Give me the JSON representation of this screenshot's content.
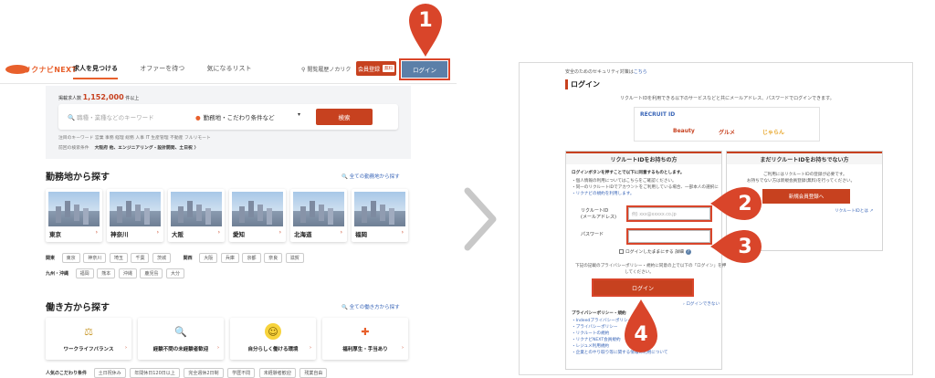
{
  "left": {
    "logo": "リクナビNEXT",
    "nav": [
      "求人を見つける",
      "オファーを待つ",
      "気になるリスト"
    ],
    "history": "閲覧履歴ノカリク",
    "register": {
      "label": "会員登録",
      "badge": "無料"
    },
    "login": "ログイン",
    "hero_count": {
      "prefix": "掲載求人数",
      "value": "1,152,000",
      "suffix": "件以上"
    },
    "search": {
      "keyword_placeholder": "職種・業種などのキーワード",
      "location": "勤務地・こだわり条件など",
      "button": "検索"
    },
    "keyword_row": "注目のキーワード  営業  事務  経理  総務  人事  IT  生産管理  不動産  フルリモート",
    "recent": {
      "label": "前回の検索条件",
      "value": "大阪府 他、エンジニアリング・設計開発、土日祝 〉"
    },
    "area_section": {
      "title": "勤務地から探す",
      "link": "全ての勤務地から探す"
    },
    "cities": [
      "東京",
      "神奈川",
      "大阪",
      "愛知",
      "北海道",
      "福岡"
    ],
    "pref_rows": [
      {
        "group1": "関東",
        "items1": [
          "東京",
          "神奈川",
          "埼玉",
          "千葉",
          "茨城"
        ],
        "group2": "関西",
        "items2": [
          "大阪",
          "兵庫",
          "京都",
          "奈良",
          "滋賀"
        ]
      },
      {
        "group1": "九州・沖縄",
        "items1": [
          "福岡",
          "熊本",
          "沖縄",
          "鹿児島",
          "大分"
        ],
        "group2": "",
        "items2": []
      }
    ],
    "style_section": {
      "title": "働き方から探す",
      "link": "全ての働き方から探す"
    },
    "styles": [
      {
        "label": "ワークライフバランス",
        "icon": "scale-icon"
      },
      {
        "label": "経験不問の未経験者歓迎",
        "icon": "magnifier-icon"
      },
      {
        "label": "自分らしく働ける環境",
        "icon": "smile-icon"
      },
      {
        "label": "福利厚生・手当あり",
        "icon": "benefit-icon"
      }
    ],
    "popular": {
      "label": "人気のこだわり条件",
      "items": [
        "土日祝休み",
        "年間休日120日以上",
        "完全週休2日制",
        "学歴不問",
        "未経験者歓迎",
        "残業自由"
      ]
    }
  },
  "right": {
    "security": "安全のためのセキュリティ対策は",
    "security_link": "こちら",
    "title": "ログイン",
    "desc": "リクルートIDを利用できる以下のサービスなどと共にメールアドレス、パスワードでログインできます。",
    "brands": [
      "RECRUIT ID",
      "Beauty",
      "グルメ",
      "じゃらん"
    ],
    "have_id": {
      "header": "リクルートIDをお持ちの方",
      "intro": "ログインボタンを押すことで以下に同意するものとします。",
      "notes": [
        "・個人情報の利用については",
        "こちら",
        "をご確認ください。",
        "・同一のリクルートIDでアカウントをご利用している場合、一部本人の選択に",
        "・リクナビの規約を利用します。"
      ],
      "id_label": [
        "リクルートID",
        "(メールアドレス)"
      ],
      "id_placeholder": "例) xxx@xxxxx.co.jp",
      "pw_label": "パスワード",
      "keep": "ログインしたままにする",
      "keep_detail": "詳細",
      "agree": [
        "下記の記載のプライバシーポリシー・規約に同意の上で以下の「ログイン」を押",
        "してください。"
      ],
      "login": "ログイン",
      "forgot": "ログインできない",
      "policy_head": "プライバシーポリシー・規約",
      "policy_items": [
        "・Indeedプライバシーポリシー",
        "・プライバシーポリシー",
        "・リクルートの規約",
        "・リクナビNEXT会員規約",
        "・レジュメ利用規約",
        "・企業とのやり取り等に関する情報の利用について"
      ]
    },
    "no_id": {
      "header": "まだリクルートIDをお持ちでない方",
      "line1": "ご利用にはリクルートIDの登録が必要です。",
      "line2": "お持ちでない方は新規会員登録(無料)を行ってください。",
      "button": "新規会員登録へ",
      "link": "リクルートIDとは"
    }
  },
  "markers": [
    "1",
    "2",
    "3",
    "4"
  ]
}
